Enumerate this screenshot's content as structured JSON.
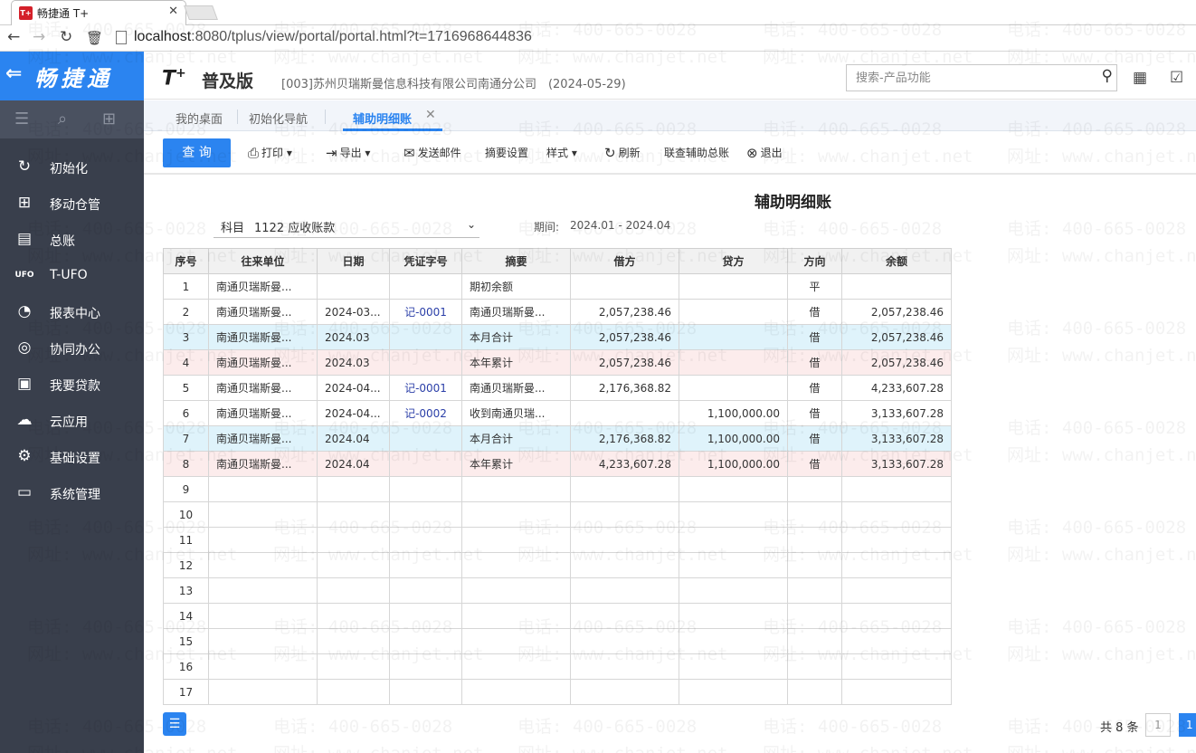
{
  "browser": {
    "tab_title": "畅捷通 T+",
    "favicon_text": "T+",
    "url_host": "localhost",
    "url_rest": ":8080/tplus/view/portal/portal.html?t=1716968644836"
  },
  "brand": {
    "name": "畅捷通"
  },
  "sidebar": {
    "items": [
      {
        "label": "初始化"
      },
      {
        "label": "移动仓管"
      },
      {
        "label": "总账"
      },
      {
        "label": "T-UFO"
      },
      {
        "label": "报表中心"
      },
      {
        "label": "协同办公"
      },
      {
        "label": "我要贷款"
      },
      {
        "label": "云应用"
      },
      {
        "label": "基础设置"
      },
      {
        "label": "系统管理"
      }
    ]
  },
  "header": {
    "product_logo": "T",
    "product_logo_sup": "+",
    "edition": "普及版",
    "company": "[003]苏州贝瑞斯曼信息科技有限公司南通分公司　(2024-05-29)",
    "search_placeholder": "搜索-产品功能"
  },
  "tabs": [
    {
      "label": "我的桌面"
    },
    {
      "label": "初始化导航"
    },
    {
      "label": "辅助明细账"
    }
  ],
  "toolbar": {
    "query": "查 询",
    "print": "打印",
    "export": "导出",
    "email": "发送邮件",
    "summary_settings": "摘要设置",
    "style": "样式",
    "refresh": "刷新",
    "linked_summary": "联查辅助总账",
    "exit": "退出"
  },
  "report": {
    "title": "辅助明细账",
    "subject_label": "科目",
    "subject_value": "1122 应收账款",
    "period_label": "期间:",
    "period_value": "2024.01 - 2024.04"
  },
  "table": {
    "headers": [
      "序号",
      "往来单位",
      "日期",
      "凭证字号",
      "摘要",
      "借方",
      "贷方",
      "方向",
      "余额"
    ],
    "rows": [
      {
        "no": "1",
        "unit": "南通贝瑞斯曼...",
        "date": "",
        "voucher": "",
        "summary": "期初余额",
        "debit": "",
        "credit": "",
        "dir": "平",
        "balance": "",
        "kind": "normal"
      },
      {
        "no": "2",
        "unit": "南通贝瑞斯曼...",
        "date": "2024-03...",
        "voucher": "记-0001",
        "summary": "南通贝瑞斯曼...",
        "debit": "2,057,238.46",
        "credit": "",
        "dir": "借",
        "balance": "2,057,238.46",
        "kind": "normal"
      },
      {
        "no": "3",
        "unit": "南通贝瑞斯曼...",
        "date": "2024.03",
        "voucher": "",
        "summary": "本月合计",
        "debit": "2,057,238.46",
        "credit": "",
        "dir": "借",
        "balance": "2,057,238.46",
        "kind": "month"
      },
      {
        "no": "4",
        "unit": "南通贝瑞斯曼...",
        "date": "2024.03",
        "voucher": "",
        "summary": "本年累计",
        "debit": "2,057,238.46",
        "credit": "",
        "dir": "借",
        "balance": "2,057,238.46",
        "kind": "year"
      },
      {
        "no": "5",
        "unit": "南通贝瑞斯曼...",
        "date": "2024-04...",
        "voucher": "记-0001",
        "summary": "南通贝瑞斯曼...",
        "debit": "2,176,368.82",
        "credit": "",
        "dir": "借",
        "balance": "4,233,607.28",
        "kind": "normal"
      },
      {
        "no": "6",
        "unit": "南通贝瑞斯曼...",
        "date": "2024-04...",
        "voucher": "记-0002",
        "summary": "收到南通贝瑞...",
        "debit": "",
        "credit": "1,100,000.00",
        "dir": "借",
        "balance": "3,133,607.28",
        "kind": "normal"
      },
      {
        "no": "7",
        "unit": "南通贝瑞斯曼...",
        "date": "2024.04",
        "voucher": "",
        "summary": "本月合计",
        "debit": "2,176,368.82",
        "credit": "1,100,000.00",
        "dir": "借",
        "balance": "3,133,607.28",
        "kind": "month"
      },
      {
        "no": "8",
        "unit": "南通贝瑞斯曼...",
        "date": "2024.04",
        "voucher": "",
        "summary": "本年累计",
        "debit": "4,233,607.28",
        "credit": "1,100,000.00",
        "dir": "借",
        "balance": "3,133,607.28",
        "kind": "year"
      },
      {
        "no": "9",
        "unit": "",
        "date": "",
        "voucher": "",
        "summary": "",
        "debit": "",
        "credit": "",
        "dir": "",
        "balance": "",
        "kind": "normal"
      },
      {
        "no": "10",
        "unit": "",
        "date": "",
        "voucher": "",
        "summary": "",
        "debit": "",
        "credit": "",
        "dir": "",
        "balance": "",
        "kind": "normal"
      },
      {
        "no": "11",
        "unit": "",
        "date": "",
        "voucher": "",
        "summary": "",
        "debit": "",
        "credit": "",
        "dir": "",
        "balance": "",
        "kind": "normal"
      },
      {
        "no": "12",
        "unit": "",
        "date": "",
        "voucher": "",
        "summary": "",
        "debit": "",
        "credit": "",
        "dir": "",
        "balance": "",
        "kind": "normal"
      },
      {
        "no": "13",
        "unit": "",
        "date": "",
        "voucher": "",
        "summary": "",
        "debit": "",
        "credit": "",
        "dir": "",
        "balance": "",
        "kind": "normal"
      },
      {
        "no": "14",
        "unit": "",
        "date": "",
        "voucher": "",
        "summary": "",
        "debit": "",
        "credit": "",
        "dir": "",
        "balance": "",
        "kind": "normal"
      },
      {
        "no": "15",
        "unit": "",
        "date": "",
        "voucher": "",
        "summary": "",
        "debit": "",
        "credit": "",
        "dir": "",
        "balance": "",
        "kind": "normal"
      },
      {
        "no": "16",
        "unit": "",
        "date": "",
        "voucher": "",
        "summary": "",
        "debit": "",
        "credit": "",
        "dir": "",
        "balance": "",
        "kind": "normal"
      },
      {
        "no": "17",
        "unit": "",
        "date": "",
        "voucher": "",
        "summary": "",
        "debit": "",
        "credit": "",
        "dir": "",
        "balance": "",
        "kind": "normal"
      }
    ]
  },
  "pagination": {
    "total": "共 8 条",
    "page_box": "1",
    "current_page": "1"
  },
  "watermark": {
    "phone": "电话: 400-665-0028",
    "site": "网址: www.chanjet.net"
  },
  "colors": {
    "accent": "#2b84f0",
    "sidebar_bg": "#393f4c",
    "month_row": "#dff3fb",
    "year_row": "#fcecec"
  }
}
